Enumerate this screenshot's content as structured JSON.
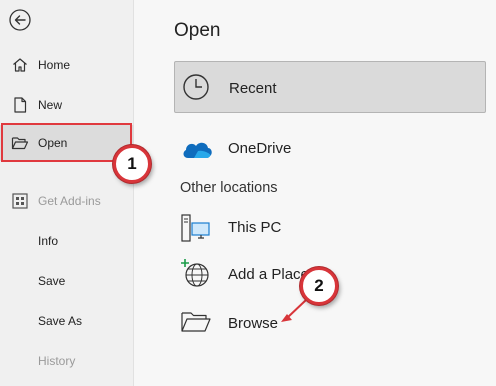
{
  "sidebar": {
    "items": [
      {
        "label": "Home",
        "icon": "home-icon",
        "enabled": true
      },
      {
        "label": "New",
        "icon": "new-document-icon",
        "enabled": true
      },
      {
        "label": "Open",
        "icon": "folder-open-icon",
        "enabled": true,
        "selected": true
      },
      {
        "label": "Get Add-ins",
        "icon": "add-ins-icon",
        "enabled": false
      },
      {
        "label": "Info",
        "enabled": true
      },
      {
        "label": "Save",
        "enabled": true
      },
      {
        "label": "Save As",
        "enabled": true
      },
      {
        "label": "History",
        "enabled": false
      }
    ]
  },
  "main": {
    "title": "Open",
    "recent_label": "Recent",
    "onedrive_label": "OneDrive",
    "other_locations_label": "Other locations",
    "this_pc_label": "This PC",
    "add_place_label": "Add a Place",
    "browse_label": "Browse"
  },
  "annotations": {
    "step1": "1",
    "step2": "2"
  },
  "colors": {
    "highlight": "#e0393e",
    "onedrive": "#0f6cbd",
    "selected_bg": "#dadada"
  }
}
